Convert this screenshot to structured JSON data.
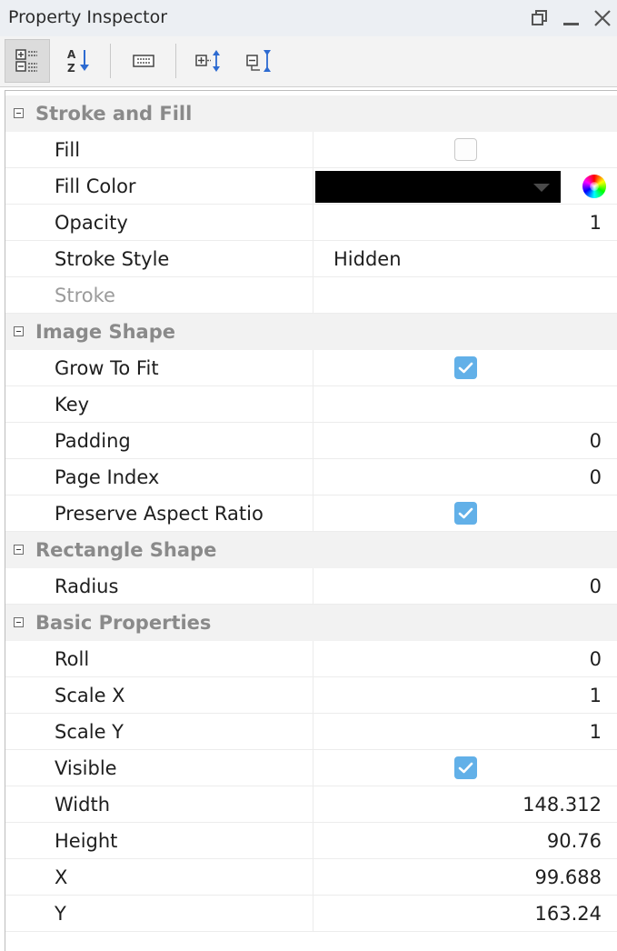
{
  "window": {
    "title": "Property Inspector",
    "icons": [
      "restore-icon",
      "minimize-icon",
      "close-icon"
    ]
  },
  "toolbar": {
    "buttons": [
      {
        "name": "categorized-view-icon",
        "active": true
      },
      {
        "name": "sort-alphabetical-icon",
        "active": false
      },
      {
        "name": "description-panel-icon",
        "active": false
      },
      {
        "name": "expand-all-icon",
        "active": false
      },
      {
        "name": "collapse-all-icon",
        "active": false
      }
    ]
  },
  "categories": {
    "stroke_fill": {
      "label": "Stroke and Fill",
      "fill": {
        "label": "Fill",
        "checked": false
      },
      "fill_color": {
        "label": "Fill Color",
        "value": "#000000"
      },
      "opacity": {
        "label": "Opacity",
        "value": "1"
      },
      "stroke_style": {
        "label": "Stroke Style",
        "value": "Hidden"
      },
      "stroke": {
        "label": "Stroke",
        "value": ""
      }
    },
    "image_shape": {
      "label": "Image Shape",
      "grow_to_fit": {
        "label": "Grow To Fit",
        "checked": true
      },
      "key": {
        "label": "Key",
        "value": ""
      },
      "padding": {
        "label": "Padding",
        "value": "0"
      },
      "page_index": {
        "label": "Page Index",
        "value": "0"
      },
      "preserve_aspect_ratio": {
        "label": "Preserve Aspect Ratio",
        "checked": true
      }
    },
    "rectangle_shape": {
      "label": "Rectangle Shape",
      "radius": {
        "label": "Radius",
        "value": "0"
      }
    },
    "basic_properties": {
      "label": "Basic Properties",
      "roll": {
        "label": "Roll",
        "value": "0"
      },
      "scale_x": {
        "label": "Scale X",
        "value": "1"
      },
      "scale_y": {
        "label": "Scale Y",
        "value": "1"
      },
      "visible": {
        "label": "Visible",
        "checked": true
      },
      "width": {
        "label": "Width",
        "value": "148.312"
      },
      "height": {
        "label": "Height",
        "value": "90.76"
      },
      "x": {
        "label": "X",
        "value": "99.688"
      },
      "y": {
        "label": "Y",
        "value": "163.24"
      }
    }
  },
  "colors": {
    "checkbox_checked": "#62b0e8",
    "category_text": "#8a8a8a",
    "category_background": "#f2f2f2"
  }
}
